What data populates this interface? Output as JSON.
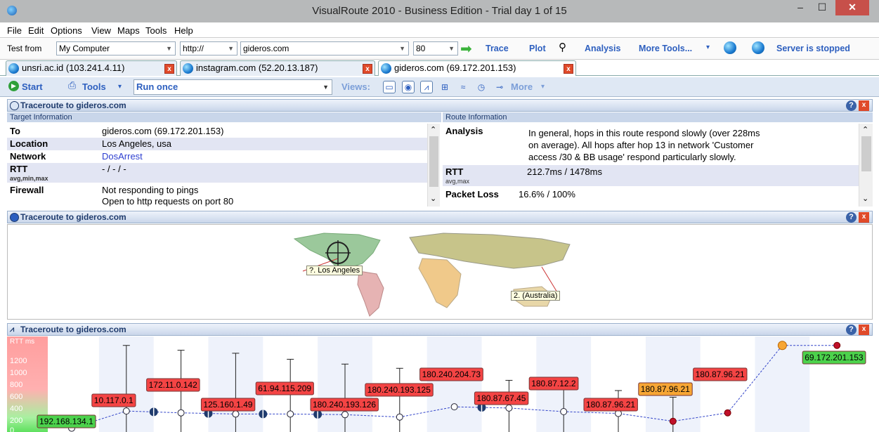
{
  "window": {
    "title": "VisualRoute 2010 - Business Edition - Trial day 1 of 15",
    "min": "–",
    "max": "☐",
    "close": "✕"
  },
  "menu": [
    "File",
    "Edit",
    "Options",
    "View",
    "Maps",
    "Tools",
    "Help"
  ],
  "toolbar": {
    "test_from_label": "Test from",
    "test_from_value": "My Computer",
    "protocol_value": "http://",
    "host_value": "gideros.com",
    "port_value": "80",
    "trace": "Trace",
    "plot": "Plot",
    "analysis": "Analysis",
    "more_tools": "More Tools...",
    "server_status": "Server is stopped"
  },
  "tabs": [
    {
      "label": "unsri.ac.id (103.241.4.11)"
    },
    {
      "label": "instagram.com (52.20.13.187)"
    },
    {
      "label": "gideros.com (69.172.201.153)"
    }
  ],
  "toolbar2": {
    "start": "Start",
    "tools": "Tools",
    "run_mode": "Run once",
    "views": "Views:",
    "more": "More"
  },
  "info_panel": {
    "title": "Traceroute to gideros.com",
    "target_header": "Target Information",
    "route_header": "Route Information",
    "target": [
      {
        "k": "To",
        "v": "gideros.com (69.172.201.153)"
      },
      {
        "k": "Location",
        "v": "Los Angeles, usa"
      },
      {
        "k": "Network",
        "v": "DosArrest"
      },
      {
        "k": "RTT",
        "sub": "avg,min,max",
        "v": "- / - / -"
      },
      {
        "k": "Firewall",
        "v": "Not responding to pings",
        "v2": "Open to http requests on port 80"
      }
    ],
    "route": {
      "analysis_label": "Analysis",
      "analysis_text": [
        "In general, hops in this route respond slowly (over 228ms",
        "on average). All hops after hop 13 in network 'Customer",
        "access /30 & BB usage' respond particularly slowly."
      ],
      "rtt_label": "RTT",
      "rtt_sub": "avg,max",
      "rtt_value": "212.7ms / 1478ms",
      "loss_label": "Packet Loss",
      "loss_value": "16.6% / 100%"
    }
  },
  "map_panel": {
    "title": "Traceroute to gideros.com",
    "labels": {
      "la": "?. Los Angeles",
      "au": "2. (Australia)"
    }
  },
  "graph_panel": {
    "title": "Traceroute to gideros.com",
    "ylabel": "RTT ms",
    "yticks": [
      "1200",
      "1000",
      "800",
      "600",
      "400",
      "200",
      "0"
    ]
  },
  "chart_data": {
    "type": "line",
    "ylabel": "RTT ms",
    "ylim": [
      0,
      1400
    ],
    "hops": [
      {
        "hop": 1,
        "ip": "192.168.134.1",
        "rtt": 5,
        "max": null,
        "status": "ok"
      },
      {
        "hop": 2,
        "ip": "10.117.0.1",
        "rtt": 290,
        "max": 1380,
        "status": "slow"
      },
      {
        "hop": 3,
        "ip": "172.11.0.142",
        "rtt": 260,
        "max": 1300,
        "status": "slow"
      },
      {
        "hop": 4,
        "ip": "125.160.1.49",
        "rtt": 240,
        "max": 1250,
        "status": "slow"
      },
      {
        "hop": 5,
        "ip": "61.94.115.209",
        "rtt": 240,
        "max": 1150,
        "status": "slow"
      },
      {
        "hop": 6,
        "ip": "180.240.193.126",
        "rtt": 230,
        "max": 1070,
        "status": "slow"
      },
      {
        "hop": 7,
        "ip": "180.240.193.125",
        "rtt": 190,
        "max": 1000,
        "status": "slow"
      },
      {
        "hop": 8,
        "ip": "180.240.204.73",
        "rtt": 360,
        "max": null,
        "status": "slow"
      },
      {
        "hop": 9,
        "ip": "180.87.67.45",
        "rtt": 340,
        "max": 800,
        "status": "slow"
      },
      {
        "hop": 10,
        "ip": "180.87.12.2",
        "rtt": 280,
        "max": 740,
        "status": "slow"
      },
      {
        "hop": 11,
        "ip": "180.87.96.21",
        "rtt": 250,
        "max": 630,
        "status": "slow"
      },
      {
        "hop": 12,
        "ip": "180.87.96.21",
        "rtt": 120,
        "max": 520,
        "status": "warn"
      },
      {
        "hop": 13,
        "ip": "180.87.96.21",
        "rtt": 260,
        "max": null,
        "status": "slow"
      },
      {
        "hop": 14,
        "ip": "",
        "rtt": 1380,
        "max": null,
        "status": "firewall"
      },
      {
        "hop": 15,
        "ip": "69.172.201.153",
        "rtt": 1380,
        "max": null,
        "status": "ok"
      }
    ]
  },
  "colors": {
    "slow": "#f44444",
    "ok": "#4cd24c",
    "warn": "#f7a634",
    "accent": "#2d5fbf"
  }
}
